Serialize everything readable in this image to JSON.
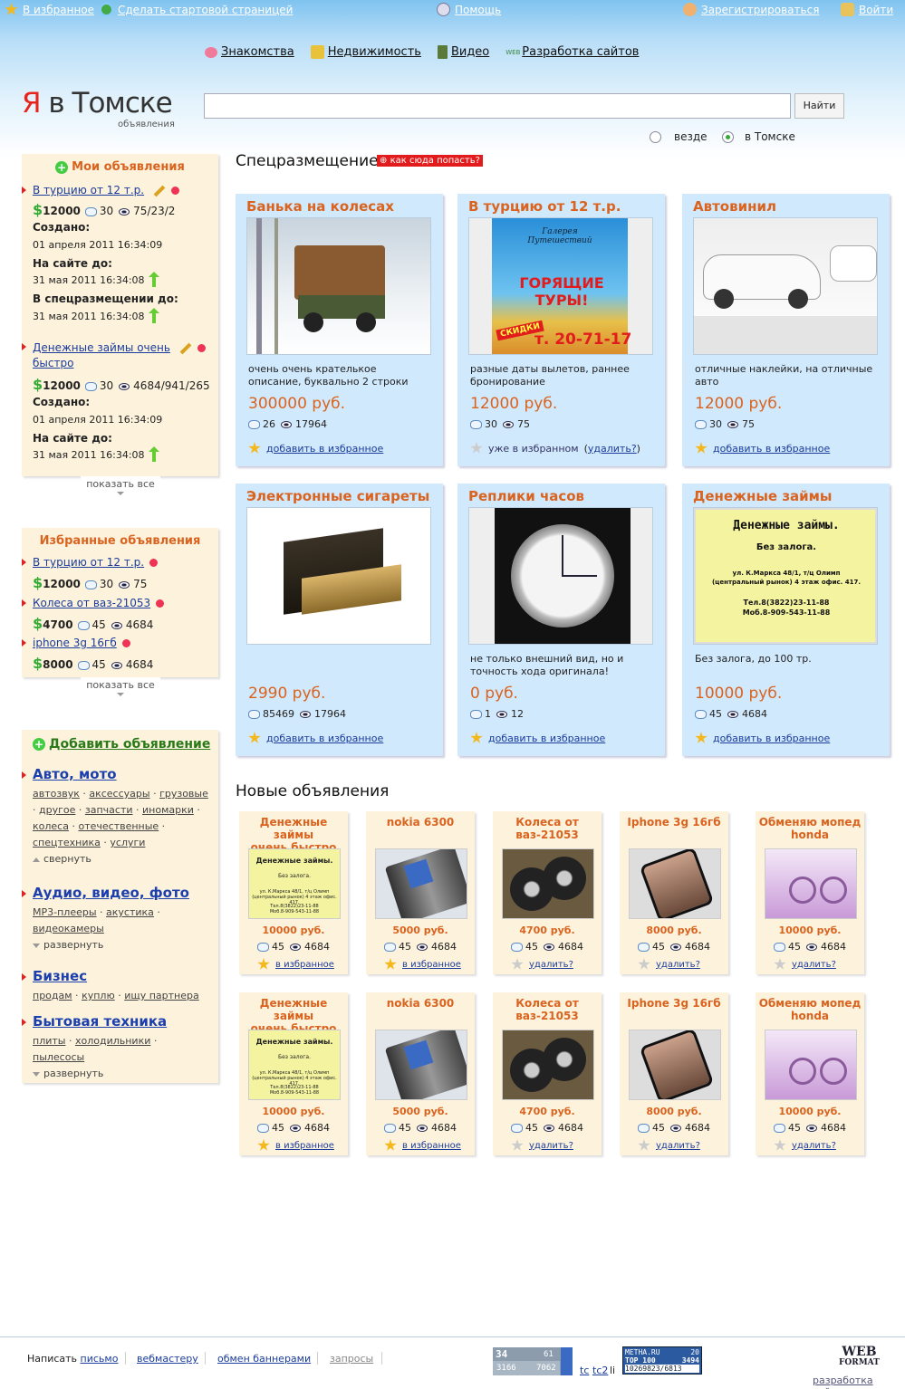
{
  "top": {
    "fav": "В избранное",
    "start": "Сделать стартовой страницей",
    "help": "Помощь",
    "register": "Зарегистрироваться",
    "login": "Войти"
  },
  "nav": [
    "Знакомства",
    "Недвижимость",
    "Видео",
    "Разработка сайтов"
  ],
  "nav_web": "WEB",
  "logo": {
    "ya": "Я",
    "city": " в Томске",
    "sub": "объявления"
  },
  "search": {
    "button": "Найти",
    "opt1": "везде",
    "opt2": "в Томске"
  },
  "my": {
    "title": "Мои объявления",
    "items": [
      {
        "link": "В турцию от 12 т.р.",
        "price": "12000",
        "comments": "30",
        "views": "75/23/2",
        "created_label": "Создано:",
        "created": "01 апреля 2011 16:34:09",
        "onsite_label": "На сайте до:",
        "onsite": "31 мая 2011 16:34:08",
        "special_label": "В спецразмещении до:",
        "special": "31 мая 2011 16:34:08"
      },
      {
        "link1": "Денежные займы очень",
        "link2": "быстро",
        "price": "12000",
        "comments": "30",
        "views": "4684/941/265",
        "created_label": "Создано:",
        "created": "01 апреля 2011 16:34:09",
        "onsite_label": "На сайте до:",
        "onsite": "31 мая 2011 16:34:08"
      }
    ],
    "more": "показать все"
  },
  "favs": {
    "title": "Избранные объявления",
    "items": [
      {
        "link": "В турцию от 12 т.р.",
        "price": "12000",
        "comments": "30",
        "views": "75"
      },
      {
        "link": "Колеса от ваз-21053",
        "price": "4700",
        "comments": "45",
        "views": "4684"
      },
      {
        "link": "iphone 3g 16гб",
        "price": "8000",
        "comments": "45",
        "views": "4684"
      }
    ],
    "more": "показать все"
  },
  "cats": {
    "add": "Добавить объявление",
    "list": [
      {
        "h": "Авто, мото",
        "subs": [
          "автозвук",
          "аксессуары",
          "грузовые",
          "другое",
          "запчасти",
          "иномарки",
          "колеса",
          "отечественные",
          "спецтехника",
          "услуги"
        ],
        "tog": "свернуть"
      },
      {
        "h": "Аудио, видео, фото",
        "subs": [
          "MP3-плееры",
          "акустика",
          "видеокамеры"
        ],
        "tog": "развернуть"
      },
      {
        "h": "Бизнес",
        "subs": [
          "продам",
          "куплю",
          "ищу партнера"
        ]
      },
      {
        "h": "Бытовая техника",
        "subs": [
          "плиты",
          "холодильники",
          "пылесосы"
        ],
        "tog": "развернуть"
      }
    ]
  },
  "special": {
    "title": "Спецразмещение",
    "how": "как сюда попасть?",
    "cards": [
      {
        "t": "Банька на колесах",
        "d": "очень очень крателькое описание, буквально 2 строки",
        "p": "300000 руб.",
        "c": "26",
        "v": "17964",
        "fav": "добавить в избранное",
        "infav": false
      },
      {
        "t": "В турцию от 12 т.р.",
        "d": "разные даты вылетов, раннее бронирование",
        "p": "12000 руб.",
        "c": "30",
        "v": "75",
        "fav": "уже в избранном",
        "del": "удалить?",
        "infav": true
      },
      {
        "t": "Автовинил",
        "d": "отличные наклейки, на отличные авто",
        "p": "12000 руб.",
        "c": "30",
        "v": "75",
        "fav": "добавить в избранное",
        "infav": false
      },
      {
        "t": "Электронные сигареты",
        "d": "",
        "p": "2990 руб.",
        "c": "85469",
        "v": "17964",
        "fav": "добавить в избранное",
        "infav": false
      },
      {
        "t": "Реплики часов",
        "d": "не только внешний вид, но и точность хода оригинала!",
        "p": "0 руб.",
        "c": "1",
        "v": "12",
        "fav": "добавить в избранное",
        "infav": false
      },
      {
        "t": "Денежные займы",
        "d": "Без залога, до 100 тр.",
        "p": "10000 руб.",
        "c": "45",
        "v": "4684",
        "fav": "добавить в избранное",
        "infav": false
      }
    ],
    "img_texts": {
      "tours1": "Галерея Путешествий",
      "tours2": "ГОРЯЩИЕ ТУРЫ!",
      "tours3": "СКИДКИ",
      "tours4": "т. 20-71-17",
      "loan1": "Денежные займы.",
      "loan2": "Без залога.",
      "loan3": "ул. К.Маркса 48/1, т/ц Олимп",
      "loan4": "(центральный рынок) 4 этаж офис. 417.",
      "loan5": "Тел.8(3822)23-11-88",
      "loan6": "Моб.8-909-543-11-88"
    }
  },
  "newads": {
    "title": "Новые объявления",
    "cards": [
      {
        "t1": "Денежные займы",
        "t2": "очень быстро",
        "p": "10000 руб.",
        "c": "45",
        "v": "4684",
        "fav": "в избранное",
        "gold": true
      },
      {
        "t1": "nokia 6300",
        "t2": "",
        "p": "5000 руб.",
        "c": "45",
        "v": "4684",
        "fav": "в избранное",
        "gold": true
      },
      {
        "t1": "Колеса от",
        "t2": "ваз-21053",
        "p": "4700 руб.",
        "c": "45",
        "v": "4684",
        "fav": "удалить?",
        "gold": false
      },
      {
        "t1": "Iphone 3g 16гб",
        "t2": "",
        "p": "8000 руб.",
        "c": "45",
        "v": "4684",
        "fav": "удалить?",
        "gold": false
      },
      {
        "t1": "Обменяю мопед",
        "t2": "honda",
        "p": "10000 руб.",
        "c": "45",
        "v": "4684",
        "fav": "удалить?",
        "gold": false
      }
    ]
  },
  "footer": {
    "write": "Написать",
    "letter": "письмо",
    "webmaster": "вебмастеру",
    "banners": "обмен баннерами",
    "requests": "запросы",
    "tc": "tc",
    "tc2": "tc2",
    "li": "li",
    "dev": "разработка сайта",
    "webformat1": "WEB",
    "webformat2": "FORMAT",
    "counter1": {
      "a": "34",
      "b": "61",
      "c": "3166",
      "d": "7062"
    },
    "counter2": {
      "a": "METHA.RU",
      "b": "20",
      "c": "TOP 100",
      "d": "3494",
      "e": "10269823/6813"
    }
  }
}
